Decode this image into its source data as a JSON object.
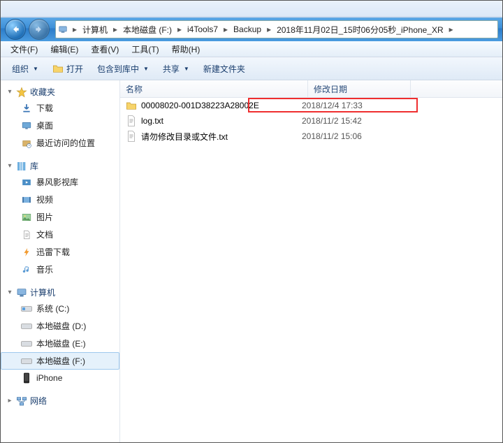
{
  "breadcrumb": {
    "items": [
      "计算机",
      "本地磁盘 (F:)",
      "i4Tools7",
      "Backup",
      "2018年11月02日_15时06分05秒_iPhone_XR"
    ]
  },
  "menubar": {
    "file": "文件(F)",
    "edit": "编辑(E)",
    "view": "查看(V)",
    "tools": "工具(T)",
    "help": "帮助(H)"
  },
  "toolbar": {
    "organize": "组织",
    "open": "打开",
    "include": "包含到库中",
    "share": "共享",
    "newfolder": "新建文件夹"
  },
  "columns": {
    "name": "名称",
    "date": "修改日期"
  },
  "sidebar": {
    "fav_head": "收藏夹",
    "fav_items": [
      {
        "label": "下载",
        "icon": "download"
      },
      {
        "label": "桌面",
        "icon": "desktop"
      },
      {
        "label": "最近访问的位置",
        "icon": "recent"
      }
    ],
    "lib_head": "库",
    "lib_items": [
      {
        "label": "暴风影视库",
        "icon": "videolib"
      },
      {
        "label": "视频",
        "icon": "video"
      },
      {
        "label": "图片",
        "icon": "pictures"
      },
      {
        "label": "文档",
        "icon": "documents"
      },
      {
        "label": "迅雷下载",
        "icon": "xl"
      },
      {
        "label": "音乐",
        "icon": "music"
      }
    ],
    "pc_head": "计算机",
    "pc_items": [
      {
        "label": "系统 (C:)",
        "icon": "drive-sys"
      },
      {
        "label": "本地磁盘 (D:)",
        "icon": "drive"
      },
      {
        "label": "本地磁盘 (E:)",
        "icon": "drive"
      },
      {
        "label": "本地磁盘 (F:)",
        "icon": "drive",
        "selected": true
      },
      {
        "label": "iPhone",
        "icon": "iphone"
      }
    ],
    "net_head": "网络"
  },
  "files": [
    {
      "name": "00008020-001D38223A28002E",
      "date": "2018/12/4 17:33",
      "type": "folder",
      "highlight": true
    },
    {
      "name": "log.txt",
      "date": "2018/11/2 15:42",
      "type": "file"
    },
    {
      "name": "请勿修改目录或文件.txt",
      "date": "2018/11/2 15:06",
      "type": "file"
    }
  ]
}
